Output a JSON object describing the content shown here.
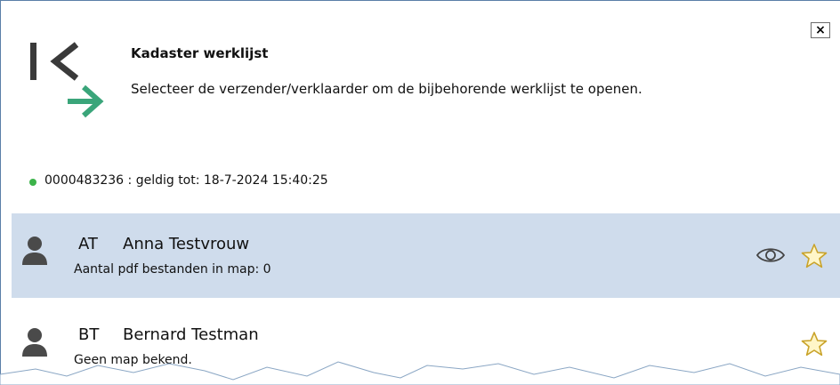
{
  "dialog": {
    "title": "Kadaster werklijst",
    "subtitle": "Selecteer de verzender/verklaarder om de bijbehorende werklijst te openen.",
    "close_label": "×"
  },
  "status": {
    "text": "0000483236 : geldig tot: 18-7-2024 15:40:25",
    "color": "#3cb34a"
  },
  "users": [
    {
      "initials": "AT",
      "name": "Anna Testvrouw",
      "detail": "Aantal pdf bestanden in map: 0",
      "selected": true,
      "icons": [
        "person-icon",
        "eye-icon",
        "star-icon"
      ]
    },
    {
      "initials": "BT",
      "name": "Bernard Testman",
      "detail": "Geen map bekend.",
      "selected": false,
      "icons": [
        "person-icon",
        "star-icon"
      ]
    }
  ],
  "colors": {
    "selected_row": "#cfdcec",
    "logo_dark": "#3a3a3a",
    "logo_accent": "#3aa57a",
    "star_fill": "#fff6c8",
    "star_stroke": "#c9a32a"
  }
}
